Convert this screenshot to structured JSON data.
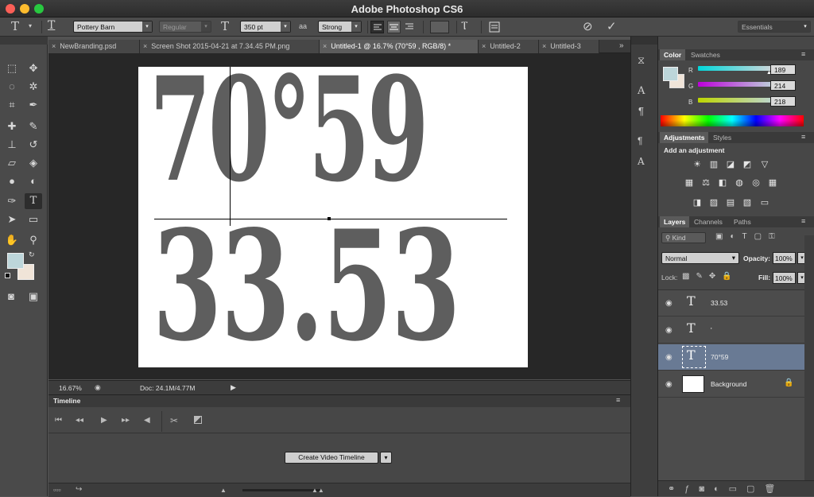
{
  "window": {
    "title": "Adobe Photoshop CS6"
  },
  "options_bar": {
    "font_family": "Pottery Barn",
    "font_style": "Regular",
    "font_size": "350 pt",
    "antialias_icon": "aa",
    "antialias": "Strong",
    "workspace": "Essentials"
  },
  "tabs": [
    {
      "label": "NewBranding.psd",
      "active": false
    },
    {
      "label": "Screen Shot 2015-04-21 at 7.34.45 PM.png",
      "active": false
    },
    {
      "label": "Untitled-1 @ 16.7% (70°59 , RGB/8) *",
      "active": true
    },
    {
      "label": "Untitled-2",
      "active": false
    },
    {
      "label": "Untitled-3",
      "active": false
    }
  ],
  "canvas": {
    "line1": "70°59",
    "line2": "33.53"
  },
  "status": {
    "zoom": "16.67%",
    "doc": "Doc: 24.1M/4.77M"
  },
  "timeline": {
    "title": "Timeline",
    "create_button": "Create Video Timeline"
  },
  "color_panel": {
    "tabs": [
      "Color",
      "Swatches"
    ],
    "r_label": "R",
    "g_label": "G",
    "b_label": "B",
    "r": "189",
    "g": "214",
    "b": "218"
  },
  "adjustments_panel": {
    "tabs": [
      "Adjustments",
      "Styles"
    ],
    "heading": "Add an adjustment"
  },
  "layers_panel": {
    "tabs": [
      "Layers",
      "Channels",
      "Paths"
    ],
    "filter": "Kind",
    "blend_mode": "Normal",
    "opacity_label": "Opacity:",
    "opacity": "100%",
    "lock_label": "Lock:",
    "fill_label": "Fill:",
    "fill": "100%",
    "layers": [
      {
        "name": "33.53",
        "type": "text",
        "selected": false
      },
      {
        "name": "'",
        "type": "text",
        "selected": false
      },
      {
        "name": "70°59",
        "type": "text",
        "selected": true
      },
      {
        "name": "Background",
        "type": "image",
        "selected": false
      }
    ]
  },
  "colors": {
    "foreground": "#bdd6da",
    "background": "#f0e4d8",
    "layer_selected": "#697a94"
  }
}
